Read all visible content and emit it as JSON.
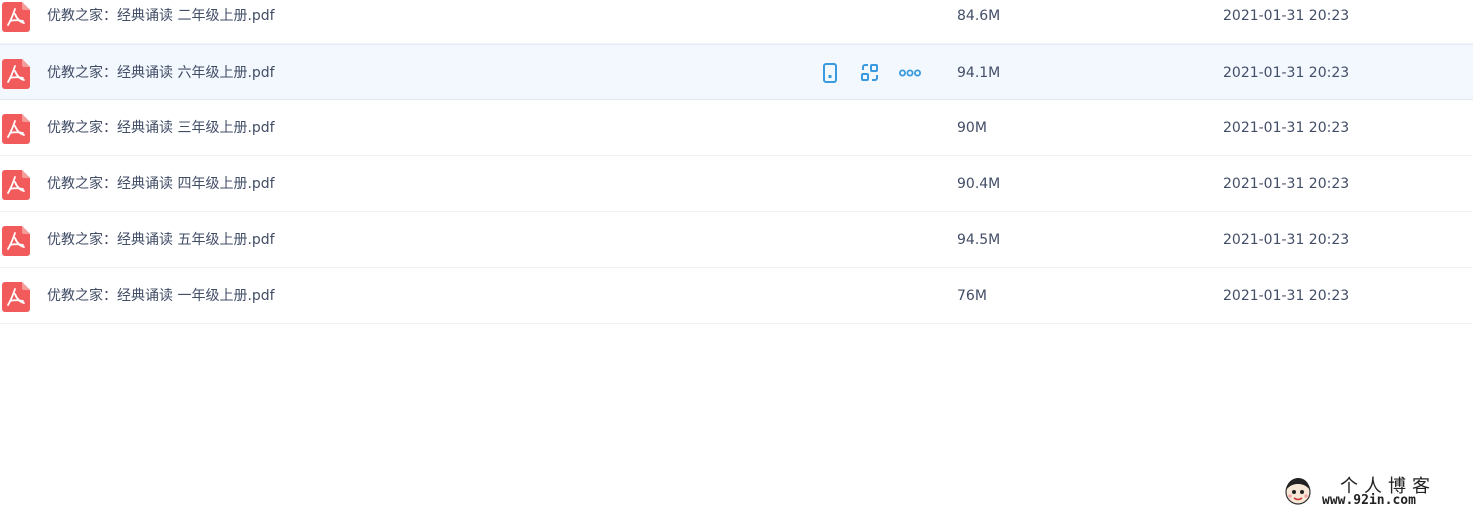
{
  "colors": {
    "pdf_red": "#f25b5b",
    "action_blue": "#3a9ae0",
    "text": "#424e67",
    "hover_bg": "#f2f8fd"
  },
  "files": [
    {
      "name": "优教之家：经典诵读 二年级上册.pdf",
      "size": "84.6M",
      "date": "2021-01-31 20:23",
      "icon": "pdf-file-icon"
    },
    {
      "name": "优教之家：经典诵读 六年级上册.pdf",
      "size": "94.1M",
      "date": "2021-01-31 20:23",
      "icon": "pdf-file-icon"
    },
    {
      "name": "优教之家：经典诵读 三年级上册.pdf",
      "size": "90M",
      "date": "2021-01-31 20:23",
      "icon": "pdf-file-icon"
    },
    {
      "name": "优教之家：经典诵读 四年级上册.pdf",
      "size": "90.4M",
      "date": "2021-01-31 20:23",
      "icon": "pdf-file-icon"
    },
    {
      "name": "优教之家：经典诵读 五年级上册.pdf",
      "size": "94.5M",
      "date": "2021-01-31 20:23",
      "icon": "pdf-file-icon"
    },
    {
      "name": "优教之家：经典诵读 一年级上册.pdf",
      "size": "76M",
      "date": "2021-01-31 20:23",
      "icon": "pdf-file-icon"
    }
  ],
  "hover_actions": [
    "phone-icon",
    "share-icon",
    "more-icon"
  ],
  "watermark": {
    "title": "个人博客",
    "url": "www.92in.com"
  }
}
